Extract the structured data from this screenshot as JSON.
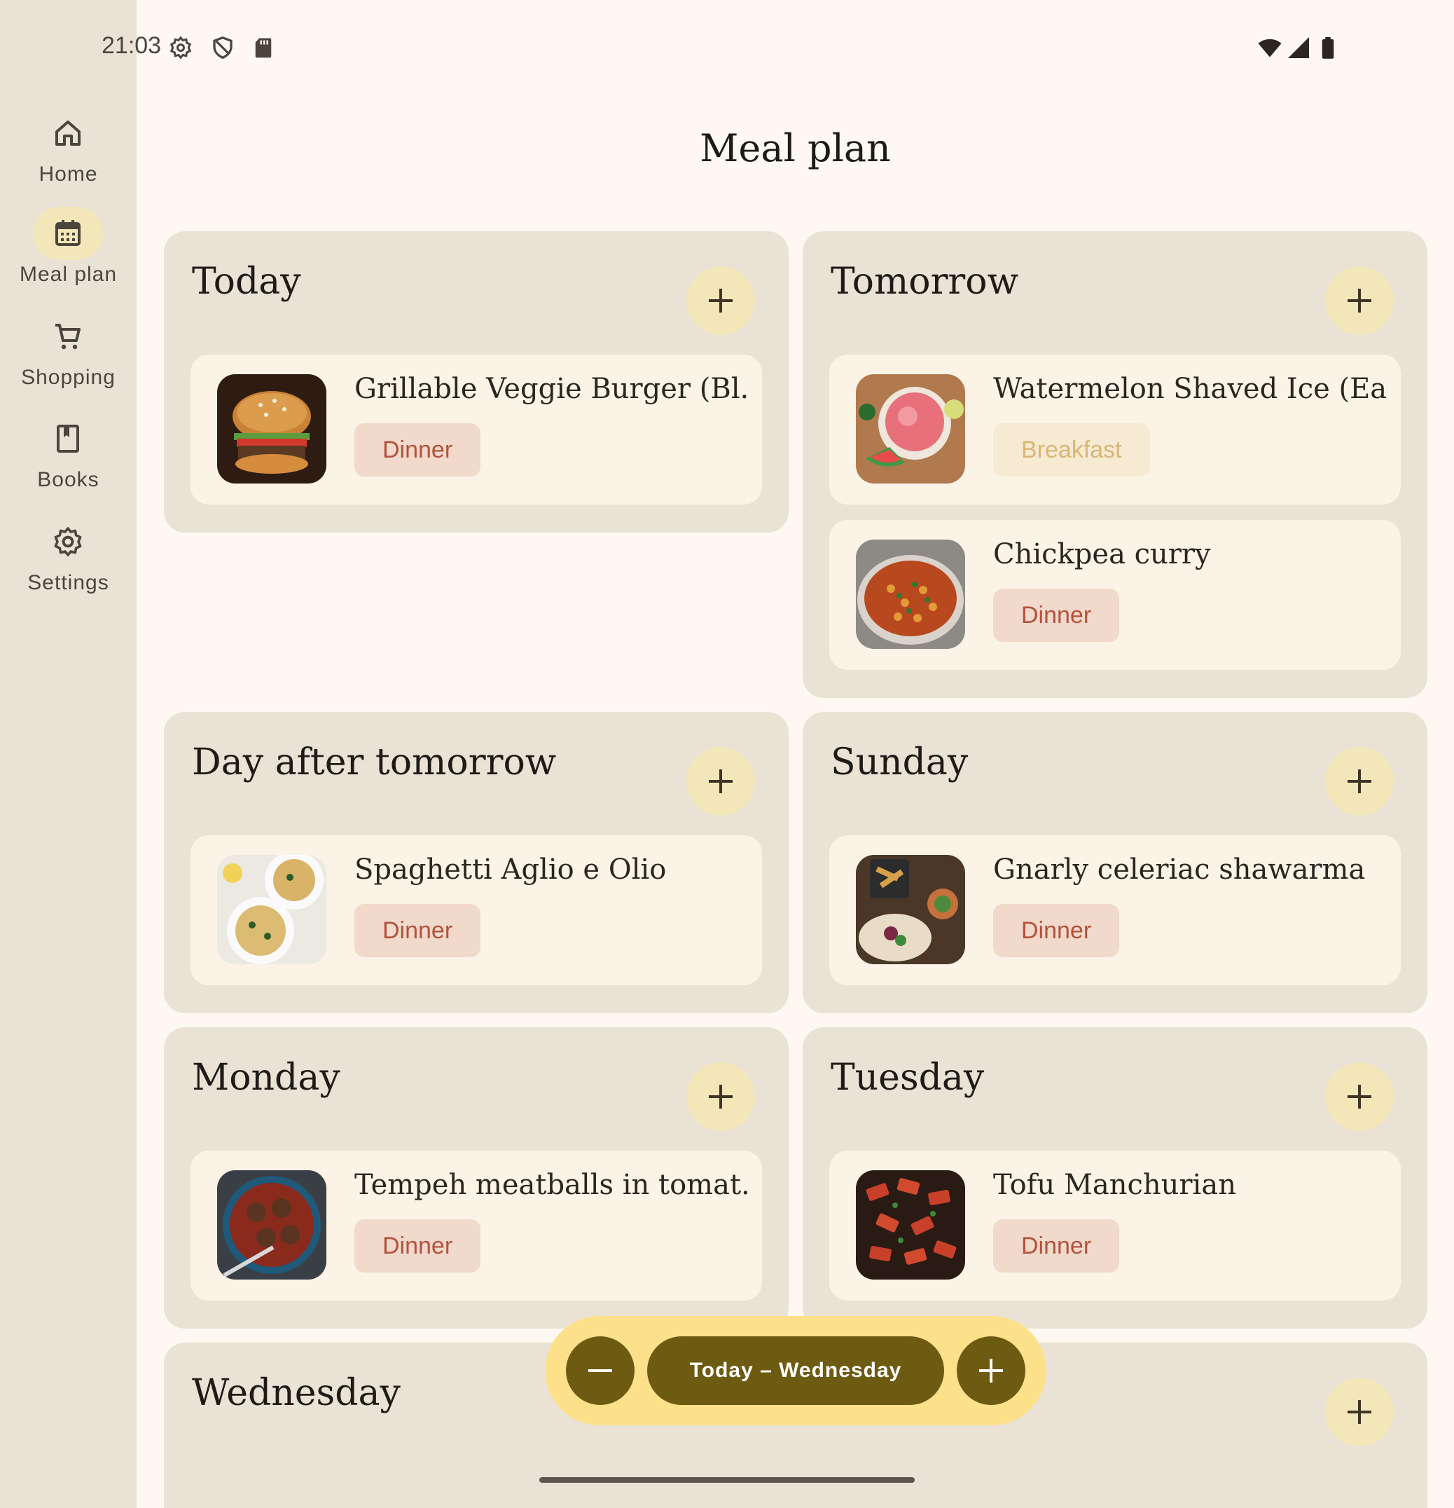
{
  "status_bar": {
    "time": "21:03",
    "left_icons": [
      "gear-icon",
      "shield-icon",
      "sd-card-icon"
    ],
    "right_icons": [
      "wifi-icon",
      "signal-icon",
      "battery-icon"
    ]
  },
  "nav_rail": {
    "items": [
      {
        "label": "Home",
        "icon": "home-icon",
        "active": false
      },
      {
        "label": "Meal plan",
        "icon": "calendar-icon",
        "active": true
      },
      {
        "label": "Shopping",
        "icon": "cart-icon",
        "active": false
      },
      {
        "label": "Books",
        "icon": "book-icon",
        "active": false
      },
      {
        "label": "Settings",
        "icon": "gear-icon",
        "active": false
      }
    ]
  },
  "page": {
    "title": "Meal plan"
  },
  "days": [
    {
      "title": "Today",
      "meals": [
        {
          "name": "Grillable Veggie Burger (Bl...",
          "tag": "Dinner"
        }
      ]
    },
    {
      "title": "Tomorrow",
      "meals": [
        {
          "name": "Watermelon Shaved Ice (Ea...",
          "tag": "Breakfast"
        },
        {
          "name": "Chickpea curry",
          "tag": "Dinner"
        }
      ]
    },
    {
      "title": "Day after tomorrow",
      "meals": [
        {
          "name": "Spaghetti Aglio e Olio",
          "tag": "Dinner"
        }
      ]
    },
    {
      "title": "Sunday",
      "meals": [
        {
          "name": "Gnarly celeriac shawarma",
          "tag": "Dinner"
        }
      ]
    },
    {
      "title": "Monday",
      "meals": [
        {
          "name": "Tempeh meatballs in tomat...",
          "tag": "Dinner"
        }
      ]
    },
    {
      "title": "Tuesday",
      "meals": [
        {
          "name": "Tofu Manchurian",
          "tag": "Dinner"
        }
      ]
    },
    {
      "title": "Wednesday",
      "meals": []
    }
  ],
  "range_control": {
    "label": "Today – Wednesday"
  },
  "colors": {
    "background": "#fdf8f1",
    "card": "#ebe2d6",
    "meal_card": "#fbf3e6",
    "accent": "#6e5b12",
    "accent_container": "#fde08a",
    "dinner_tag_bg": "#f1d9cc",
    "dinner_tag_text": "#b3523c",
    "breakfast_tag_bg": "#f6ead2",
    "breakfast_tag_text": "#d8b676"
  }
}
